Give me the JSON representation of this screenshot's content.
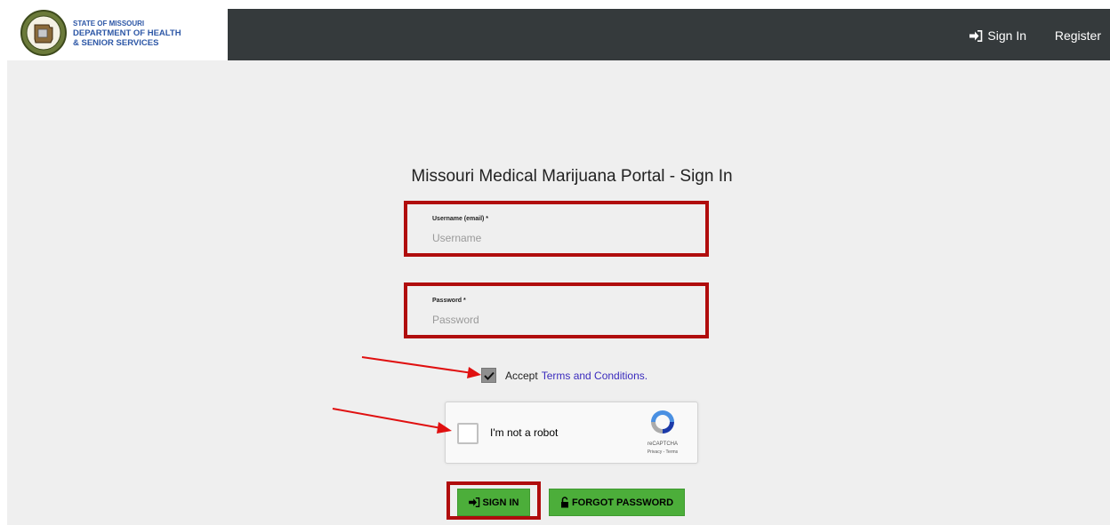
{
  "header": {
    "brand_line1": "STATE OF MISSOURI",
    "brand_line2": "DEPARTMENT OF HEALTH",
    "brand_line3": "& SENIOR SERVICES",
    "nav_signin": "Sign In",
    "nav_register": "Register"
  },
  "form": {
    "title": "Missouri Medical Marijuana Portal - Sign In",
    "username_label": "Username (email) *",
    "username_placeholder": "Username",
    "username_value": "",
    "password_label": "Password *",
    "password_placeholder": "Password",
    "password_value": "",
    "accept_prefix": "Accept",
    "terms_link": "Terms and Conditions.",
    "accept_checked": true,
    "signin_button": "SIGN IN",
    "forgot_button": "FORGOT PASSWORD"
  },
  "recaptcha": {
    "label": "I'm not a robot",
    "brand": "reCAPTCHA",
    "privacy": "Privacy - Terms",
    "checked": false
  },
  "colors": {
    "navbar": "#353a3c",
    "brand_blue": "#2d57a6",
    "highlight_red": "#b00d0d",
    "button_green": "#4cae3a",
    "link_purple": "#3a2bbd",
    "arrow_red": "#e01010"
  },
  "icons": {
    "nav_signin": "sign-in-icon",
    "signin_button": "sign-in-icon",
    "forgot_button": "unlock-icon",
    "checkbox": "checkmark-icon",
    "recaptcha": "recaptcha-logo-icon"
  }
}
